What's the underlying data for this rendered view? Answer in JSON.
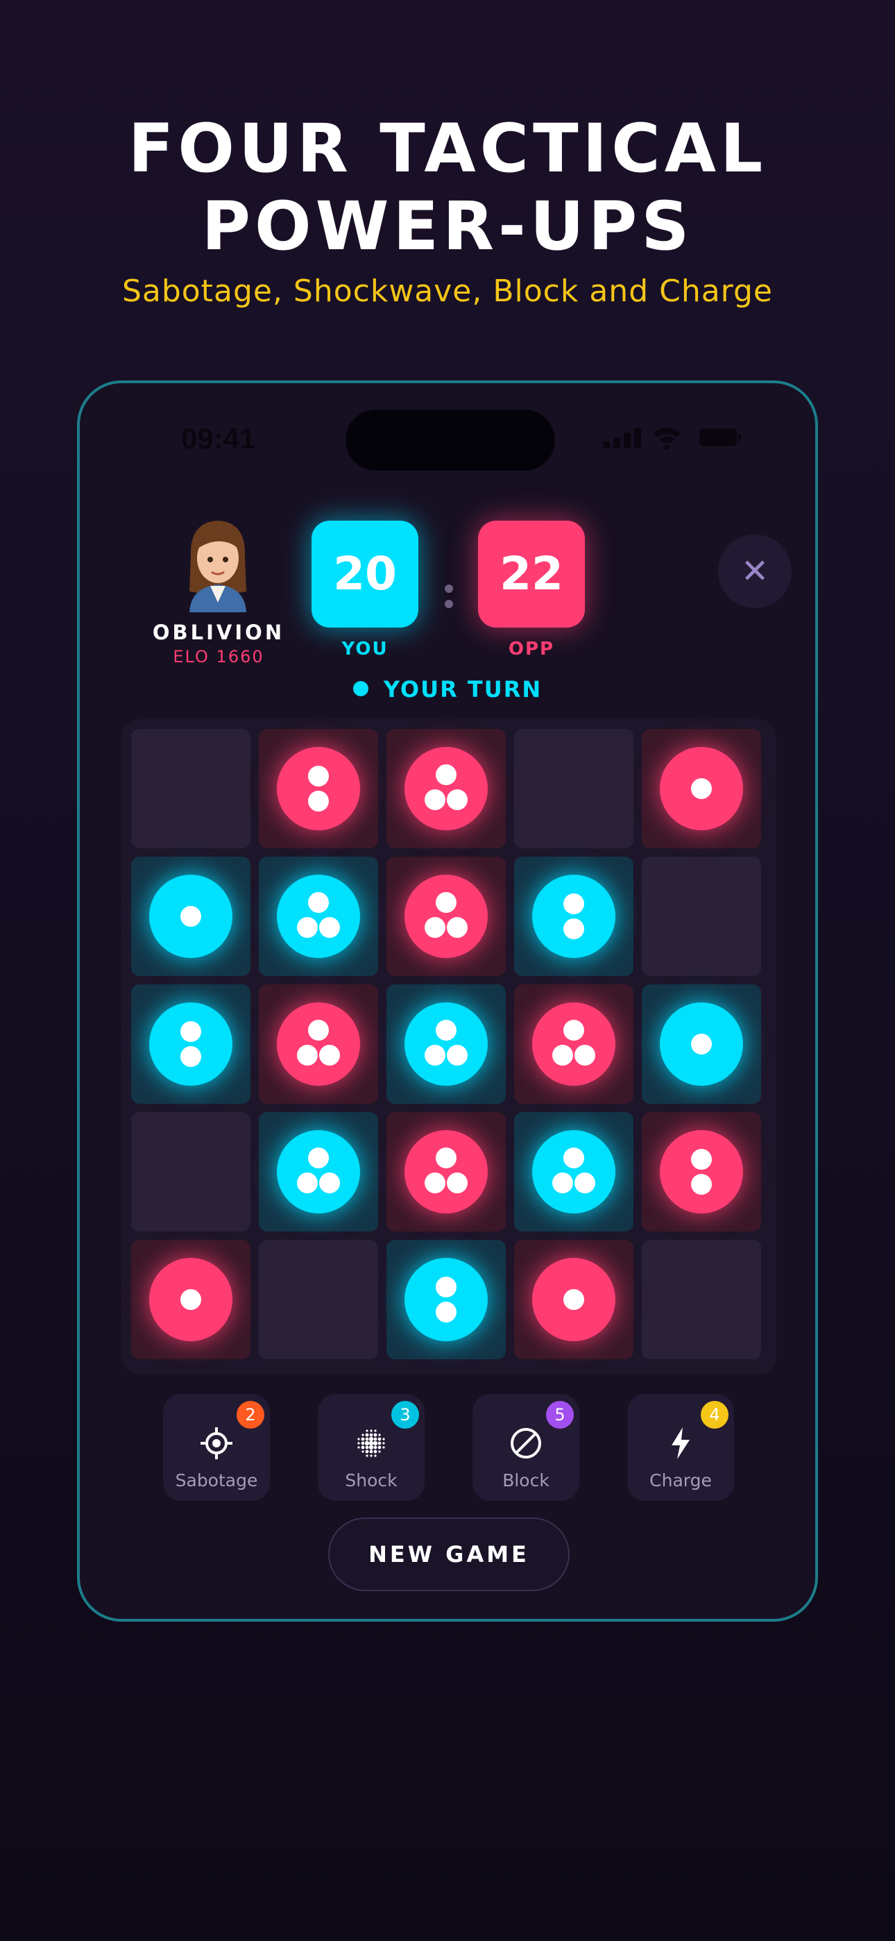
{
  "promo": {
    "headline_line1": "FOUR TACTICAL",
    "headline_line2": "POWER-UPS",
    "subheadline": "Sabotage, Shockwave, Block and Charge"
  },
  "status_bar": {
    "time": "09:41"
  },
  "player": {
    "name": "OBLIVION",
    "elo": "ELO 1660",
    "avatar_icon": "avatar-girl-icon"
  },
  "score": {
    "you": "20",
    "opp": "22",
    "you_label": "YOU",
    "opp_label": "OPP"
  },
  "turn_indicator": "YOUR TURN",
  "close_icon": "close-icon",
  "colors": {
    "cyan": "#00e0ff",
    "pink": "#ff3d73",
    "gold": "#f5c518"
  },
  "board": {
    "rows": 5,
    "cols": 5,
    "cells": [
      [
        {
          "owner": null,
          "dots": 0
        },
        {
          "owner": "opp",
          "dots": 2
        },
        {
          "owner": "opp",
          "dots": 3
        },
        {
          "owner": null,
          "dots": 0
        },
        {
          "owner": "opp",
          "dots": 1
        }
      ],
      [
        {
          "owner": "you",
          "dots": 1
        },
        {
          "owner": "you",
          "dots": 3
        },
        {
          "owner": "opp",
          "dots": 3
        },
        {
          "owner": "you",
          "dots": 2
        },
        {
          "owner": null,
          "dots": 0
        }
      ],
      [
        {
          "owner": "you",
          "dots": 2
        },
        {
          "owner": "opp",
          "dots": 3
        },
        {
          "owner": "you",
          "dots": 3
        },
        {
          "owner": "opp",
          "dots": 3
        },
        {
          "owner": "you",
          "dots": 1
        }
      ],
      [
        {
          "owner": null,
          "dots": 0
        },
        {
          "owner": "you",
          "dots": 3
        },
        {
          "owner": "opp",
          "dots": 3
        },
        {
          "owner": "you",
          "dots": 3
        },
        {
          "owner": "opp",
          "dots": 2
        }
      ],
      [
        {
          "owner": "opp",
          "dots": 1
        },
        {
          "owner": null,
          "dots": 0
        },
        {
          "owner": "you",
          "dots": 2
        },
        {
          "owner": "opp",
          "dots": 1
        },
        {
          "owner": null,
          "dots": 0
        }
      ]
    ]
  },
  "powerups": [
    {
      "label": "Sabotage",
      "count": "2",
      "icon": "crosshair-icon",
      "badge_color": "#ff5a1f"
    },
    {
      "label": "Shock",
      "count": "3",
      "icon": "shockwave-icon",
      "badge_color": "#00c2e0"
    },
    {
      "label": "Block",
      "count": "5",
      "icon": "block-icon",
      "badge_color": "#a34ff0"
    },
    {
      "label": "Charge",
      "count": "4",
      "icon": "lightning-icon",
      "badge_color": "#f5c518"
    }
  ],
  "new_game_label": "NEW GAME"
}
